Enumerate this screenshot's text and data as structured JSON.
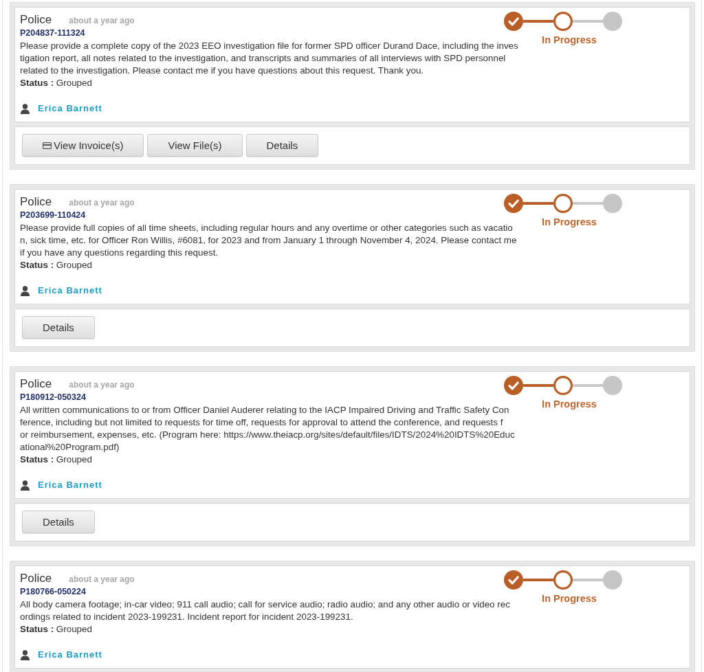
{
  "requests": [
    {
      "department": "Police",
      "time": "about a year ago",
      "id": "P204837-111324",
      "description": [
        "Please provide a complete copy of the 2023 EEO investigation file for former SPD officer Durand Dace, including the inves",
        "tigation report, all notes related to the investigation, and transcripts and summaries of all interviews with SPD personnel",
        "related to the investigation. Please contact me if you have questions about this request. Thank you."
      ],
      "status": "**Status :** Grouped",
      "requester": "Erica Barnett",
      "progress": {
        "steps": [
          {
            "kind": "done"
          },
          {
            "kind": "current"
          },
          {
            "kind": "pending"
          }
        ],
        "label": "In Progress"
      },
      "actions": [
        {
          "label": "View Invoice(s)",
          "kind": "invoice"
        },
        {
          "label": "View File(s)",
          "kind": "plain"
        },
        {
          "label": "Details",
          "kind": "plain"
        }
      ]
    },
    {
      "department": "Police",
      "time": "about a year ago",
      "id": "P203699-110424",
      "description": [
        "Please provide full copies of all time sheets, including regular hours and any overtime or other categories such as vacatio",
        "n, sick time, etc. for Officer Ron Willis, #6081, for 2023 and from January 1 through November 4, 2024. Please contact me",
        "if you have any questions regarding this request."
      ],
      "status": "**Status :** Grouped",
      "requester": "Erica Barnett",
      "progress": {
        "steps": [
          {
            "kind": "done"
          },
          {
            "kind": "current"
          },
          {
            "kind": "pending"
          }
        ],
        "label": "In Progress"
      },
      "actions": [
        {
          "label": "Details",
          "kind": "plain"
        }
      ]
    },
    {
      "department": "Police",
      "time": "about a year ago",
      "id": "P180912-050324",
      "description": [
        "All written communications to or from Officer Daniel Auderer relating to the IACP Impaired Driving and Traffic Safety Con",
        "ference, including but not limited to requests for time off, requests for approval to attend the conference, and requests f",
        "or reimbursement, expenses, etc. (Program here: https://www.theiacp.org/sites/default/files/IDTS/2024%20IDTS%20Educ",
        "ational%20Program.pdf)"
      ],
      "status": "**Status :** Grouped",
      "requester": "Erica Barnett",
      "progress": {
        "steps": [
          {
            "kind": "done"
          },
          {
            "kind": "current"
          },
          {
            "kind": "pending"
          }
        ],
        "label": "In Progress"
      },
      "actions": [
        {
          "label": "Details",
          "kind": "plain"
        }
      ]
    },
    {
      "department": "Police",
      "time": "about a year ago",
      "id": "P180766-050224",
      "description": [
        "All body camera footage; in-car video; 911 call audio; call for service audio; radio audio; and any other audio or video rec",
        "ordings related to incident 2023-199231. Incident report for incident 2023-199231."
      ],
      "status": "**Status :** Grouped",
      "requester": "Erica Barnett",
      "progress": {
        "steps": [
          {
            "kind": "done"
          },
          {
            "kind": "current"
          },
          {
            "kind": "pending"
          }
        ],
        "label": "In Progress"
      }
    }
  ]
}
